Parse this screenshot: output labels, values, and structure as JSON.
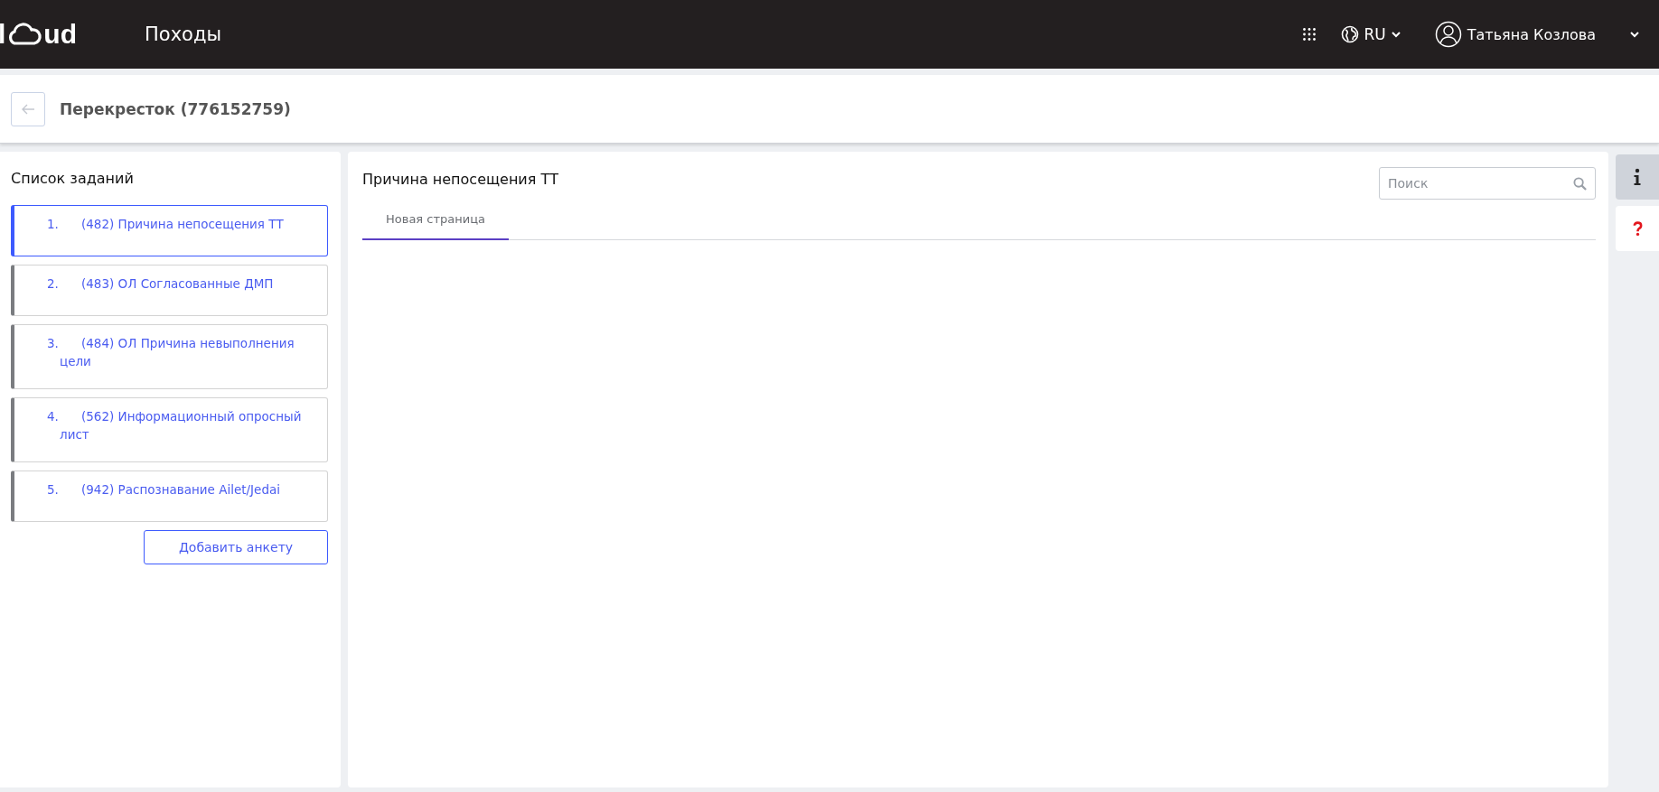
{
  "topbar": {
    "logo_left": "l",
    "logo_right": "ud",
    "title": "Походы",
    "language": "RU",
    "user_name": "Татьяна Козлова"
  },
  "header": {
    "title": "Перекресток (776152759)"
  },
  "task_list": {
    "title": "Список заданий",
    "items": [
      {
        "number": "1.",
        "title": "(482) Причина непосещения ТТ",
        "selected": true
      },
      {
        "number": "2.",
        "title": "(483) ОЛ Согласованные ДМП",
        "selected": false
      },
      {
        "number": "3.",
        "title": "(484) ОЛ Причина невыполнения цели",
        "selected": false
      },
      {
        "number": "4.",
        "title": "(562) Информационный опросный лист",
        "selected": false
      },
      {
        "number": "5.",
        "title": "(942) Распознавание Ailet/Jedai",
        "selected": false
      }
    ],
    "add_button": "Добавить анкету"
  },
  "content": {
    "title": "Причина непосещения ТТ",
    "search": {
      "placeholder": "Поиск"
    },
    "tabs": [
      {
        "label": "Новая страница",
        "selected": true
      }
    ]
  },
  "side_tabs": [
    {
      "kind": "info",
      "selected": true
    },
    {
      "kind": "help",
      "selected": false
    }
  ]
}
